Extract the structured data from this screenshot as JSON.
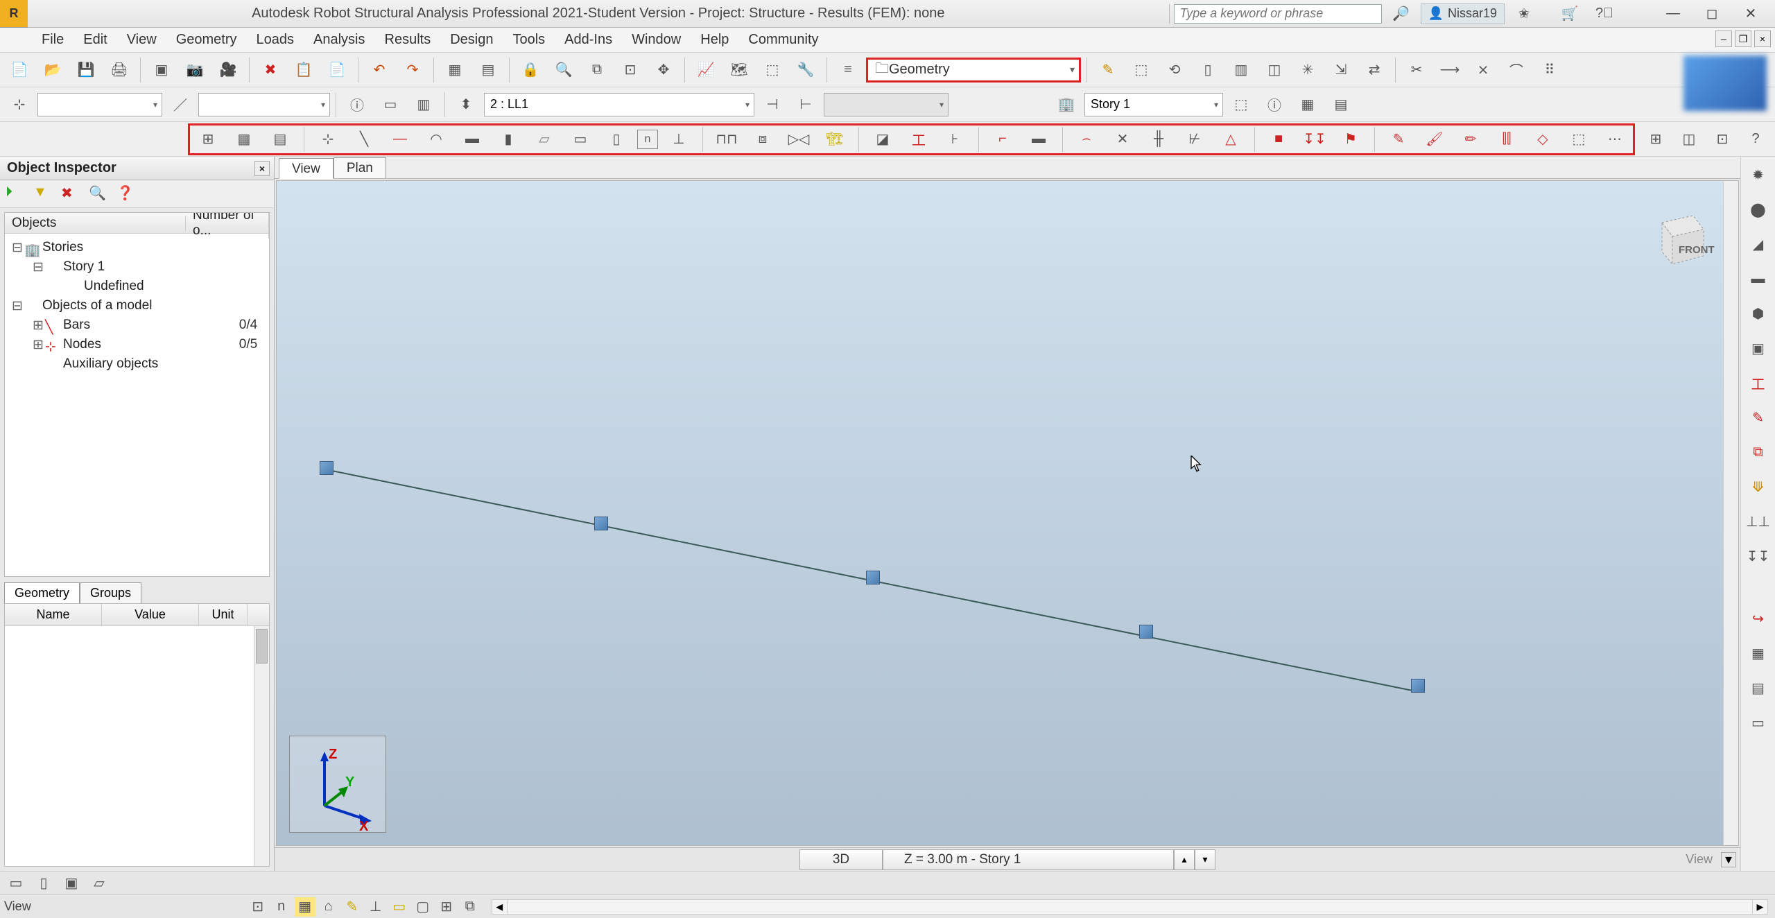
{
  "title": "Autodesk Robot Structural Analysis Professional 2021-Student Version - Project: Structure - Results (FEM): none",
  "search_placeholder": "Type a keyword or phrase",
  "user": "Nissar19",
  "menu": [
    "File",
    "Edit",
    "View",
    "Geometry",
    "Loads",
    "Analysis",
    "Results",
    "Design",
    "Tools",
    "Add-Ins",
    "Window",
    "Help",
    "Community"
  ],
  "layout_dropdown": "Geometry",
  "load_case": "2 : LL1",
  "story_dropdown": "Story 1",
  "inspector_title": "Object Inspector",
  "tree_headers": {
    "col1": "Objects",
    "col2": "Number of o..."
  },
  "tree": {
    "stories": "Stories",
    "story1": "Story 1",
    "undefined": "Undefined",
    "objects_model": "Objects of a model",
    "bars": "Bars",
    "bars_count": "0/4",
    "nodes": "Nodes",
    "nodes_count": "0/5",
    "aux": "Auxiliary objects"
  },
  "bottom_tabs": {
    "geometry": "Geometry",
    "groups": "Groups"
  },
  "prop_headers": {
    "name": "Name",
    "value": "Value",
    "unit": "Unit"
  },
  "view_tabs": {
    "view": "View",
    "plan": "Plan"
  },
  "view_cube_face": "FRONT",
  "axis": {
    "x": "X",
    "y": "Y",
    "z": "Z"
  },
  "status": {
    "mode": "3D",
    "coord": "Z = 3.00 m - Story 1",
    "view_label": "View",
    "bl_tab": "View"
  }
}
